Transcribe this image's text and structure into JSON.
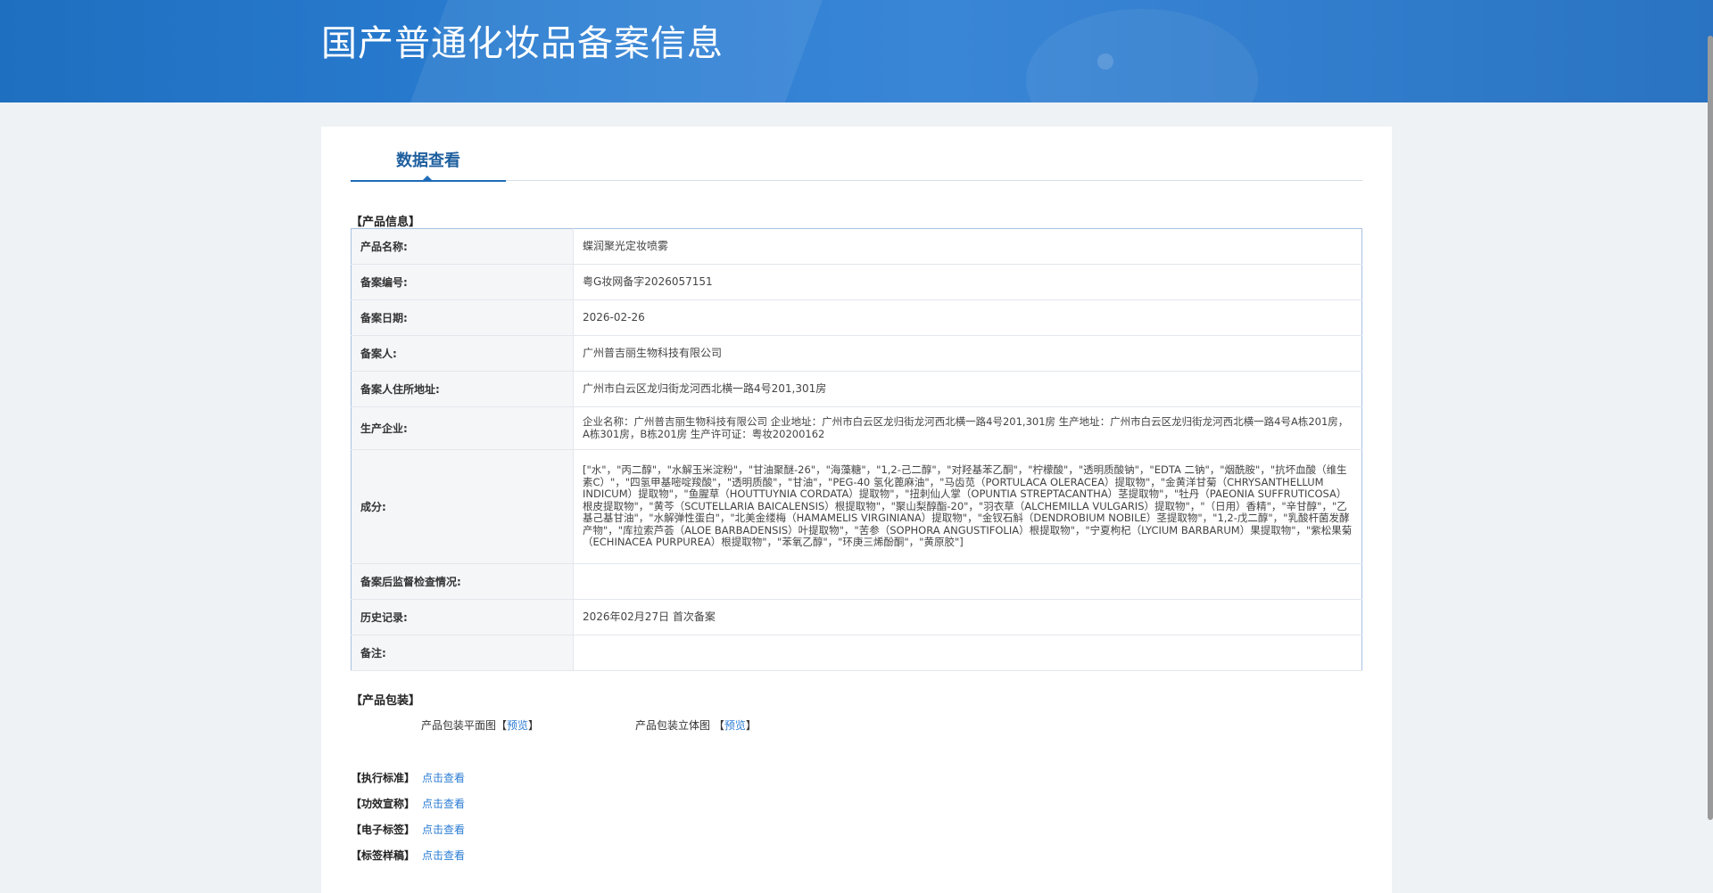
{
  "header": {
    "title": "国产普通化妆品备案信息"
  },
  "tabs": [
    {
      "label": "数据查看"
    }
  ],
  "product_info": {
    "section_title": "【产品信息】",
    "rows": [
      {
        "label": "产品名称:",
        "value": "蝶润聚光定妆喷雾"
      },
      {
        "label": "备案编号:",
        "value": "粤G妆网备字2026057151"
      },
      {
        "label": "备案日期:",
        "value": "2026-02-26"
      },
      {
        "label": "备案人:",
        "value": "广州普吉丽生物科技有限公司"
      },
      {
        "label": "备案人住所地址:",
        "value": "广州市白云区龙归街龙河西北横一路4号201,301房"
      },
      {
        "label": "生产企业:",
        "value": "企业名称：广州普吉丽生物科技有限公司 企业地址：广州市白云区龙归街龙河西北横一路4号201,301房 生产地址：广州市白云区龙归街龙河西北横一路4号A栋201房，A栋301房，B栋201房 生产许可证：粤妆20200162"
      },
      {
        "label": "成分:",
        "value": "[\"水\"，\"丙二醇\"，\"水解玉米淀粉\"，\"甘油聚醚-26\"，\"海藻糖\"，\"1,2-己二醇\"，\"对羟基苯乙酮\"，\"柠檬酸\"，\"透明质酸钠\"，\"EDTA 二钠\"，\"烟酰胺\"，\"抗坏血酸（维生素C）\"，\"四氢甲基嘧啶羧酸\"，\"透明质酸\"，\"甘油\"，\"PEG-40 氢化蓖麻油\"，\"马齿苋（PORTULACA OLERACEA）提取物\"，\"金黄洋甘菊（CHRYSANTHELLUM INDICUM）提取物\"，\"鱼腥草（HOUTTUYNIA CORDATA）提取物\"，\"扭刺仙人掌（OPUNTIA STREPTACANTHA）茎提取物\"，\"牡丹（PAEONIA SUFFRUTICOSA）根皮提取物\"，\"黄芩（SCUTELLARIA BAICALENSIS）根提取物\"，\"聚山梨醇酯-20\"，\"羽衣草（ALCHEMILLA VULGARIS）提取物\"，\"（日用）香精\"，\"辛甘醇\"，\"乙基己基甘油\"，\"水解弹性蛋白\"，\"北美金缕梅（HAMAMELIS VIRGINIANA）提取物\"，\"金钗石斛（DENDROBIUM NOBILE）茎提取物\"，\"1,2-戊二醇\"，\"乳酸杆菌发酵产物\"，\"库拉索芦荟（ALOE BARBADENSIS）叶提取物\"，\"苦参（SOPHORA ANGUSTIFOLIA）根提取物\"，\"宁夏枸杞（LYCIUM BARBARUM）果提取物\"，\"紫松果菊（ECHINACEA PURPUREA）根提取物\"，\"苯氧乙醇\"，\"环庚三烯酚酮\"，\"黄原胶\"]"
      },
      {
        "label": "备案后监督检查情况:",
        "value": ""
      },
      {
        "label": "历史记录:",
        "value": "2026年02月27日 首次备案"
      },
      {
        "label": "备注:",
        "value": ""
      }
    ]
  },
  "packaging": {
    "section_title": "【产品包装】",
    "flat_label": "产品包装平面图",
    "stereo_label": "产品包装立体图",
    "bracket_open": "【",
    "bracket_close": "】",
    "preview_label": "预览"
  },
  "links": [
    {
      "label": "【执行标准】",
      "action": "点击查看"
    },
    {
      "label": "【功效宣称】",
      "action": "点击查看"
    },
    {
      "label": "【电子标签】",
      "action": "点击查看"
    },
    {
      "label": "【标签样稿】",
      "action": "点击查看"
    }
  ],
  "colors": {
    "banner": "#2b7ed3",
    "link": "#2b7cd3",
    "tab_active": "#1e5f9e",
    "table_border": "#a9c1e0"
  }
}
